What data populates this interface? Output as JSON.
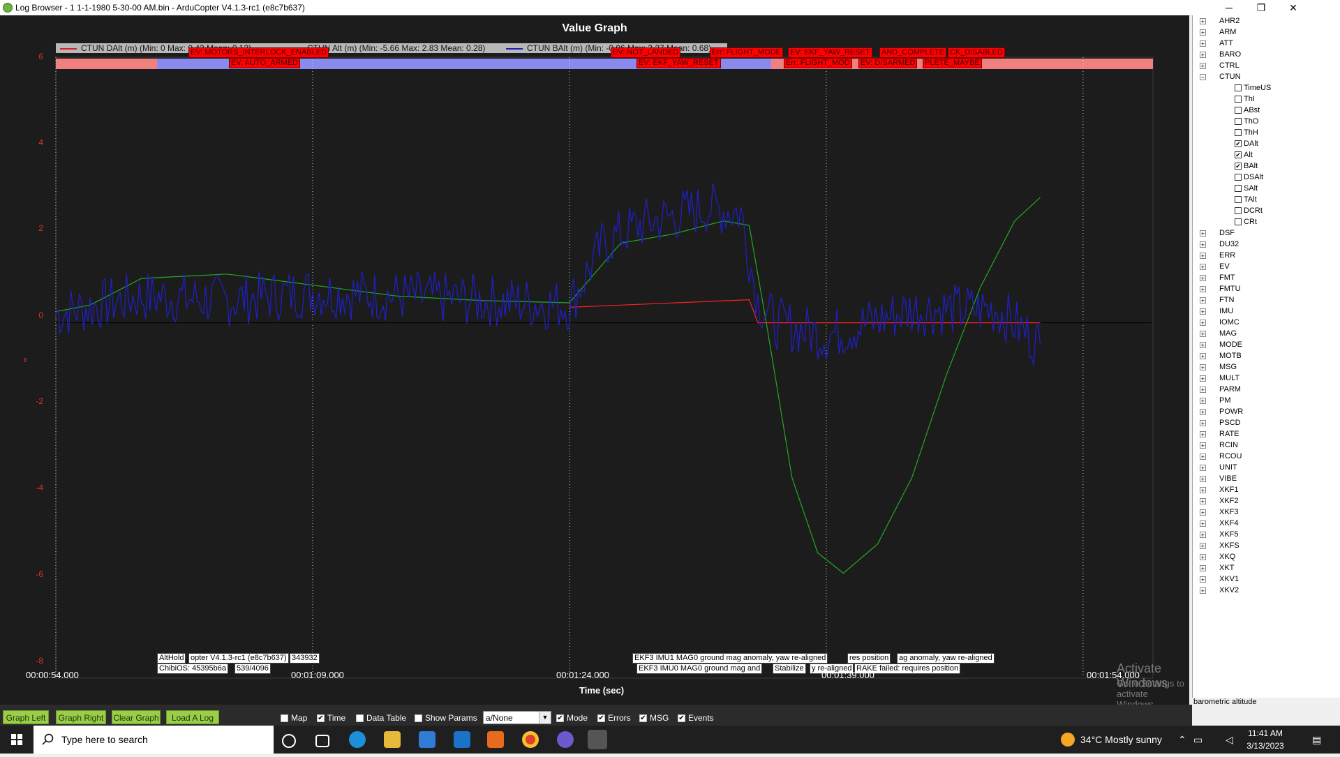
{
  "window": {
    "title": "Log Browser - 1 1-1-1980 5-30-00 AM.bin - ArduCopter V4.1.3-rc1 (e8c7b637)",
    "minimize": "─",
    "restore": "❐",
    "close": "✕"
  },
  "graph": {
    "title": "Value Graph",
    "x_axis_title": "Time (sec)",
    "y_axis_unit": "ε",
    "y_ticks": [
      "6",
      "4",
      "2",
      "0",
      "-2",
      "-4",
      "-6",
      "-8"
    ],
    "x_ticks": [
      "00:00:54.000",
      "00:01:09.000",
      "00:01:24.000",
      "00:01:39.000",
      "00:01:54.000"
    ],
    "legend": [
      {
        "text": "CTUN DAlt (m)  (Min: 0 Max: 0.42 Mean: 0.13)",
        "color": "#ff2020"
      },
      {
        "text": "CTUN Alt (m)  (Min: -5.66 Max: 2.83 Mean: 0.28)",
        "color": "#22aa22"
      },
      {
        "text": "CTUN BAlt (m)  (Min: -0.96 Max: 3.27 Mean: 0.68)",
        "color": "#2020cc"
      }
    ],
    "event_labels": [
      "EV: MOTORS_INTERLOCK_ENABLED",
      "EV: AUTO_ARMED",
      "EV: NOT_LANDED",
      "EV: EKF_YAW_RESET",
      "Err: FLIGHT_MODE",
      "EV: EKF_YAW_RESET",
      "AND_COMPLETE",
      "CK_DISABLED",
      "Err: FLIGHT_MOD",
      "EV: DISARMED",
      "PLETE_MAYBE"
    ],
    "msg_labels": [
      "AltHold",
      "opter V4.1.3-rc1 (e8c7b637)",
      "343932",
      "ChibiOS: 45395b6a",
      "539/4096",
      "EKF3 IMU1 MAG0 ground mag anomaly, yaw re-aligned",
      "res position",
      "ag anomaly, yaw re-aligned",
      "EKF3 IMU0 MAG0 ground mag and",
      "Stabilize",
      "y re-aligned",
      "RAKE failed: requires position"
    ],
    "watermark_title": "Activate Windows",
    "watermark_sub": "Go to Settings to activate Windows."
  },
  "chart_data": {
    "type": "line",
    "xlabel": "Time (sec)",
    "ylabel": "",
    "xlim": [
      "00:00:54.000",
      "00:01:58.000"
    ],
    "ylim": [
      -8,
      6
    ],
    "x": [
      0,
      5,
      10,
      15,
      20,
      25,
      30,
      35,
      40,
      45,
      50,
      55,
      60,
      65
    ],
    "series": [
      {
        "name": "CTUN DAlt (m)",
        "color": "#ff2020",
        "x": [
          30,
          40.5,
          41,
          57.5
        ],
        "values": [
          0.35,
          0.52,
          0.0,
          0.0
        ]
      },
      {
        "name": "CTUN Alt (m)",
        "color": "#22aa22",
        "x": [
          0,
          2,
          5,
          10,
          15,
          20,
          25,
          30,
          33,
          36,
          39,
          40.5,
          41.5,
          43,
          44.5,
          46,
          48,
          50,
          52,
          54,
          56,
          57.5
        ],
        "values": [
          0.25,
          0.4,
          1.0,
          1.1,
          0.85,
          0.6,
          0.5,
          0.45,
          1.8,
          2.0,
          2.3,
          2.2,
          0.0,
          -3.5,
          -5.2,
          -5.66,
          -5.0,
          -3.5,
          -1.2,
          0.8,
          2.3,
          2.83
        ]
      },
      {
        "name": "CTUN BAlt (m)",
        "color": "#2020cc",
        "x": [
          0,
          5,
          10,
          15,
          20,
          25,
          30,
          32,
          34,
          36,
          38,
          40,
          41,
          42,
          45,
          50,
          55,
          57.5
        ],
        "values": [
          0.2,
          0.6,
          0.5,
          0.7,
          0.6,
          0.5,
          0.4,
          1.8,
          2.2,
          2.4,
          2.6,
          2.5,
          0.5,
          0.0,
          -0.3,
          0.3,
          0.3,
          -0.5
        ]
      }
    ]
  },
  "tree": {
    "groups_before": [
      "AHR2",
      "ARM",
      "ATT",
      "BARO",
      "CTRL"
    ],
    "expanded_group": "CTUN",
    "children": [
      {
        "label": "TimeUS",
        "checked": false
      },
      {
        "label": "ThI",
        "checked": false
      },
      {
        "label": "ABst",
        "checked": false
      },
      {
        "label": "ThO",
        "checked": false
      },
      {
        "label": "ThH",
        "checked": false
      },
      {
        "label": "DAlt",
        "checked": true
      },
      {
        "label": "Alt",
        "checked": true
      },
      {
        "label": "BAlt",
        "checked": true
      },
      {
        "label": "DSAlt",
        "checked": false
      },
      {
        "label": "SAlt",
        "checked": false
      },
      {
        "label": "TAlt",
        "checked": false
      },
      {
        "label": "DCRt",
        "checked": false
      },
      {
        "label": "CRt",
        "checked": false
      }
    ],
    "groups_after": [
      "DSF",
      "DU32",
      "ERR",
      "EV",
      "FMT",
      "FMTU",
      "FTN",
      "IMU",
      "IOMC",
      "MAG",
      "MODE",
      "MOTB",
      "MSG",
      "MULT",
      "PARM",
      "PM",
      "POWR",
      "PSCD",
      "RATE",
      "RCIN",
      "RCOU",
      "UNIT",
      "VIBE",
      "XKF1",
      "XKF2",
      "XKF3",
      "XKF4",
      "XKF5",
      "XKFS",
      "XKQ",
      "XKT",
      "XKV1",
      "XKV2"
    ],
    "status_text": "barometric altitude"
  },
  "controls": {
    "buttons": [
      "Graph Left",
      "Graph Right",
      "Clear Graph",
      "Load A Log"
    ],
    "checkboxes": [
      {
        "label": "Map",
        "checked": false
      },
      {
        "label": "Time",
        "checked": true
      },
      {
        "label": "Data Table",
        "checked": false
      },
      {
        "label": "Show Params",
        "checked": false
      }
    ],
    "combo_value": "a/None",
    "checkboxes2": [
      {
        "label": "Mode",
        "checked": true
      },
      {
        "label": "Errors",
        "checked": true
      },
      {
        "label": "MSG",
        "checked": true
      },
      {
        "label": "Events",
        "checked": true
      }
    ]
  },
  "taskbar": {
    "search_placeholder": "Type here to search",
    "weather": "34°C  Mostly sunny",
    "time": "11:41 AM",
    "date": "3/13/2023"
  }
}
